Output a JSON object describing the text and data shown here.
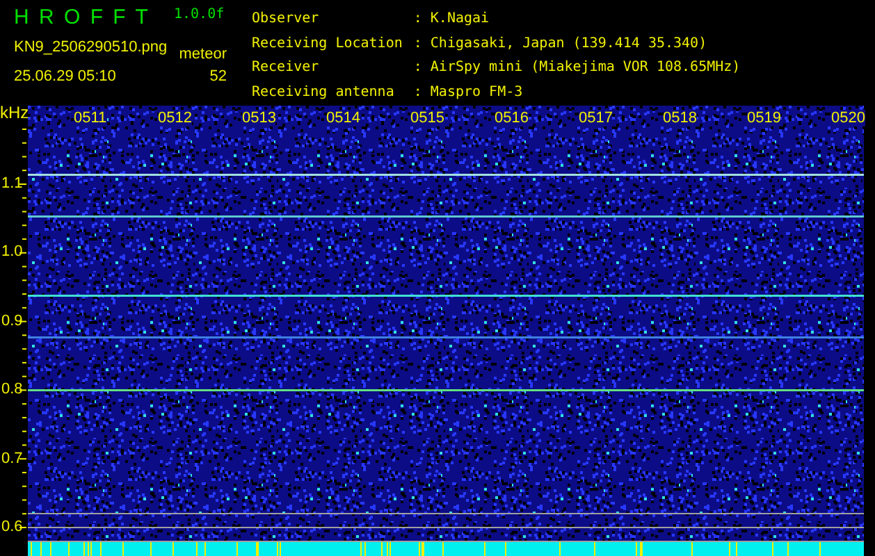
{
  "header": {
    "title": "H R O F F T",
    "version": "1.0.0f",
    "filename": "KN9_2506290510.png",
    "datetime": "25.06.29 05:10",
    "counter_label": "meteor",
    "counter_value": "52"
  },
  "info": [
    {
      "label": "Observer",
      "separator": ":",
      "value": "K.Nagai"
    },
    {
      "label": "Receiving Location",
      "separator": ":",
      "value": "Chigasaki, Japan (139.414 35.340)"
    },
    {
      "label": "Receiver",
      "separator": ":",
      "value": "AirSpy mini (Miakejima VOR 108.65MHz)"
    },
    {
      "label": "Receiving antenna",
      "separator": ":",
      "value": "Maspro FM-3"
    }
  ],
  "plot": {
    "unit": "kHz",
    "y_labels": [
      "1.1",
      "1.0",
      "0.9",
      "0.8",
      "0.7",
      "0.6"
    ],
    "time_labels": [
      "0511",
      "0512",
      "0513",
      "0514",
      "0515",
      "0516",
      "0517",
      "0518",
      "0519",
      "0520"
    ]
  }
}
